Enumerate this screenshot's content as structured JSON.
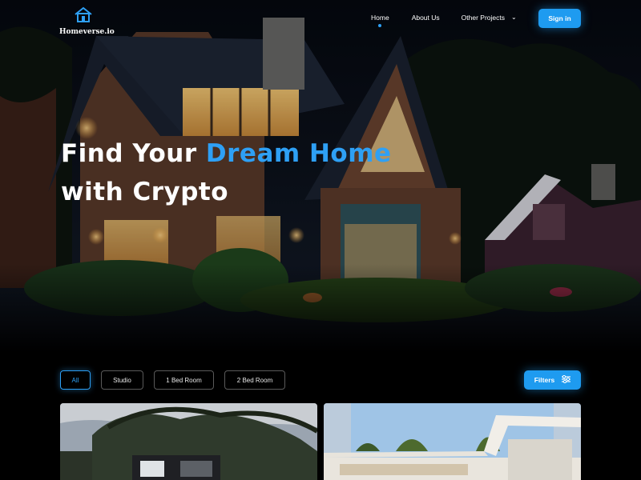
{
  "brand": {
    "name": "Homeverse.io",
    "logo_icon": "house-icon"
  },
  "nav": {
    "items": [
      {
        "label": "Home",
        "active": true
      },
      {
        "label": "About Us",
        "active": false
      },
      {
        "label": "Other Projects",
        "active": false,
        "has_dropdown": true
      }
    ],
    "dropdown_icon": "chevron-down-icon",
    "signin_label": "Sign in"
  },
  "hero": {
    "headline_part1": "Find Your ",
    "headline_accent": "Dream Home",
    "headline_part2": "with Crypto",
    "background_image": "house-at-night-photo"
  },
  "filters": {
    "chips": [
      {
        "label": "All",
        "active": true
      },
      {
        "label": "Studio",
        "active": false
      },
      {
        "label": "1 Bed Room",
        "active": false
      },
      {
        "label": "2 Bed Room",
        "active": false
      }
    ],
    "filters_button_label": "Filters",
    "filters_icon": "sliders-icon"
  },
  "listings": [
    {
      "image": "modern-house-trees-photo"
    },
    {
      "image": "white-flat-roof-house-photo"
    }
  ],
  "colors": {
    "accent": "#2ea0f5",
    "button": "#1e9bf0",
    "background": "#000000"
  }
}
